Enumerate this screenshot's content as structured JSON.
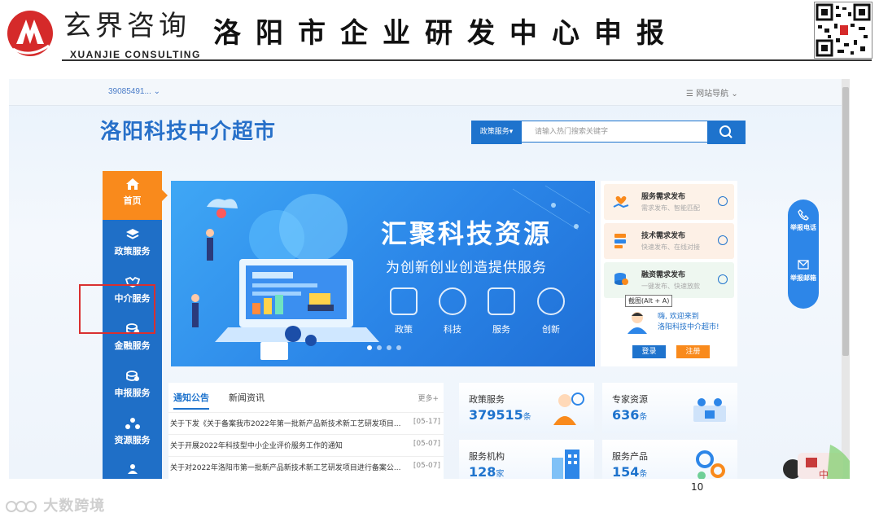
{
  "slide": {
    "brand_cn": "玄界咨询",
    "brand_en": "XUANJIE CONSULTING",
    "title": "洛阳市企业研发中心申报",
    "page_number": "10",
    "watermark": "大数跨境"
  },
  "site": {
    "account": "39085491... ⌄",
    "nav_guide": "☰  网站导航  ⌄",
    "title": "洛阳科技中介超市",
    "search": {
      "category": "政策服务▾",
      "placeholder": "请输入热门搜索关键字"
    },
    "sidebar": [
      {
        "label": "首页",
        "icon": "home-icon",
        "active": true
      },
      {
        "label": "政策服务",
        "icon": "layers-icon"
      },
      {
        "label": "中介服务",
        "icon": "handshake-icon"
      },
      {
        "label": "金融服务",
        "icon": "coins-icon"
      },
      {
        "label": "申报服务",
        "icon": "report-icon"
      },
      {
        "label": "资源服务",
        "icon": "network-icon"
      }
    ],
    "banner": {
      "title": "汇聚科技资源",
      "subtitle": "为创新创业创造提供服务",
      "icons": [
        {
          "label": "政策",
          "icon": "document-icon"
        },
        {
          "label": "科技",
          "icon": "molecule-icon"
        },
        {
          "label": "服务",
          "icon": "heart-hand-icon"
        },
        {
          "label": "创新",
          "icon": "bulb-icon"
        }
      ]
    },
    "services": [
      {
        "title": "服务需求发布",
        "sub": "需求发布、智能匹配",
        "icon": "heart-hand-icon",
        "bg": "#fdf2e8"
      },
      {
        "title": "技术需求发布",
        "sub": "快速发布、在线对接",
        "icon": "database-icon",
        "bg": "#fdf0e6"
      },
      {
        "title": "融资需求发布",
        "sub": "一键发布、快速放款",
        "icon": "coins-icon",
        "bg": "#eef7f0"
      }
    ],
    "tooltip": "截图(Alt + A)",
    "welcome": {
      "line1": "嗨, 欢迎来到",
      "line2": "洛阳科技中介超市!"
    },
    "login_label": "登录",
    "register_label": "注册",
    "news": {
      "tabs": [
        "通知公告",
        "新闻资讯"
      ],
      "more": "更多+",
      "items": [
        {
          "title": "关于下发《关于备案我市2022年第一批新产品新技术新工艺研发项目...",
          "date": "[05-17]"
        },
        {
          "title": "关于开展2022年科技型中小企业评价服务工作的通知",
          "date": "[05-07]"
        },
        {
          "title": "关于对2022年洛阳市第一批新产品新技术新工艺研发项目进行备案公...",
          "date": "[05-07]"
        }
      ]
    },
    "stats": [
      {
        "label": "政策服务",
        "value": "379515",
        "unit": "条"
      },
      {
        "label": "专家资源",
        "value": "636",
        "unit": "条"
      },
      {
        "label": "服务机构",
        "value": "128",
        "unit": "家"
      },
      {
        "label": "服务产品",
        "value": "154",
        "unit": "条"
      }
    ],
    "float": {
      "phone": "举报电话",
      "mail": "举报邮箱"
    },
    "corner_char": "中"
  }
}
